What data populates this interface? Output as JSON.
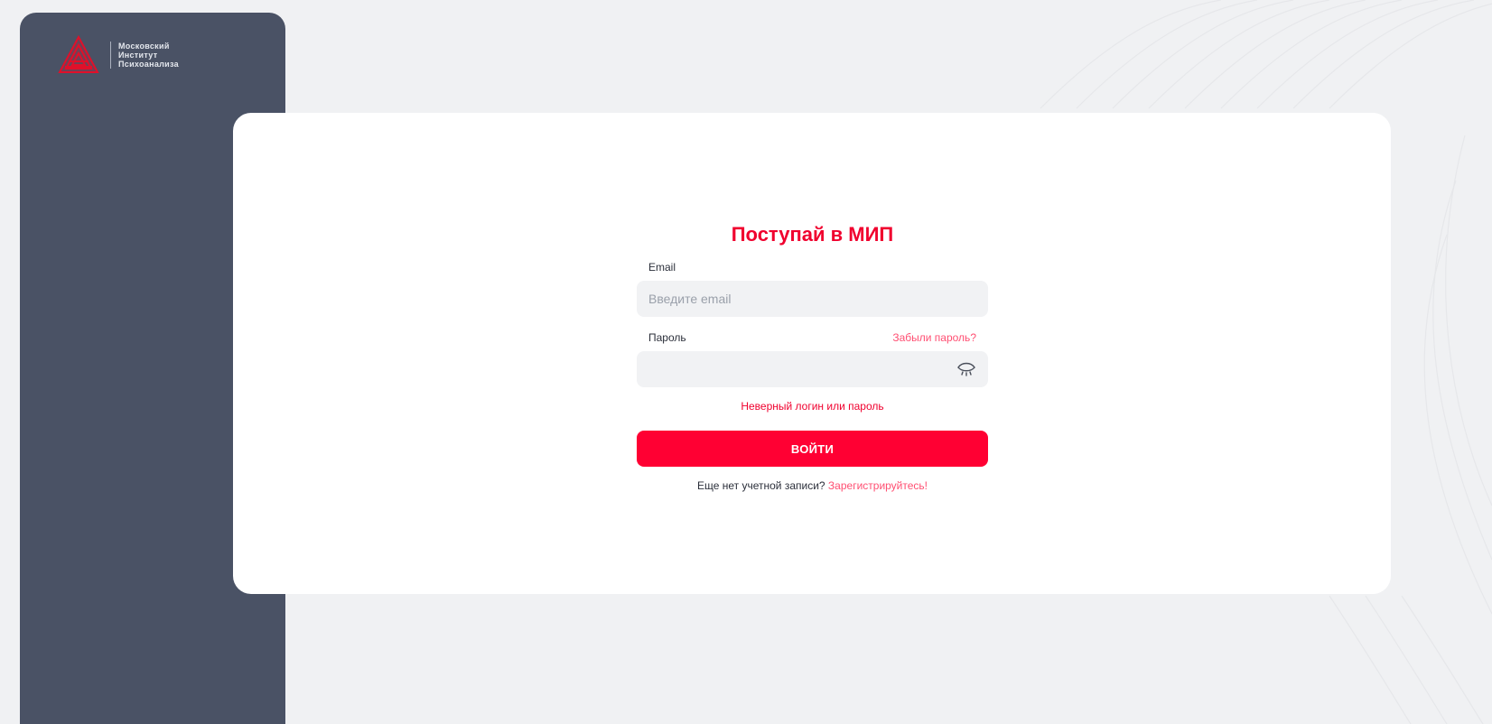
{
  "sidebar": {
    "logo": {
      "lines": [
        "Московский",
        "Институт",
        "Психоанализа"
      ],
      "icon": "triangle-logo-icon",
      "color": "#e0102a"
    }
  },
  "form": {
    "title": "Поступай в МИП",
    "email": {
      "label": "Email",
      "placeholder": "Введите email",
      "value": ""
    },
    "password": {
      "label": "Пароль",
      "forgot_link": "Забыли пароль?",
      "value": "",
      "toggle_icon": "eye-closed-icon"
    },
    "error": "Неверный логин или пароль",
    "submit_label": "ВОЙТИ",
    "register_prompt": "Еще нет учетной записи?",
    "register_link": "Зарегистрируйтесь!"
  },
  "colors": {
    "accent": "#ff0033",
    "sidebar": "#4a5265",
    "background": "#f0f1f3"
  }
}
